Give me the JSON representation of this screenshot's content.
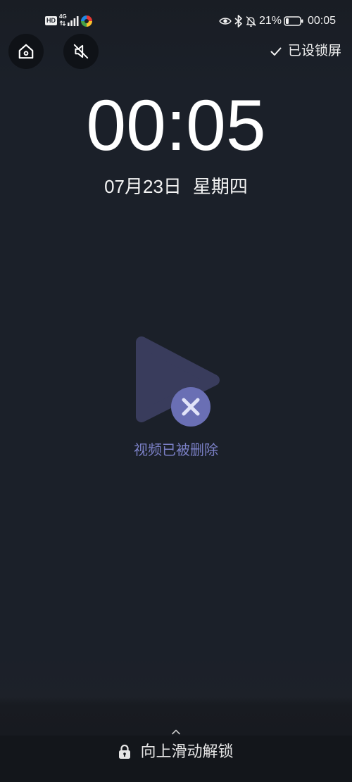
{
  "status_bar": {
    "hd_label": "HD",
    "network_type": "4G",
    "signal_level": 4,
    "battery_label": "21%",
    "battery_level": 0.21,
    "time": "00:05",
    "icons": [
      "data-activity-icon",
      "signal-icon",
      "app-notification-icon",
      "eye-icon",
      "bluetooth-icon",
      "bell-off-icon",
      "battery-icon"
    ]
  },
  "top_controls": {
    "home_icon": "home-icon",
    "mute_icon": "sound-off-icon",
    "check_icon": "check-icon",
    "lock_wallpaper_label": "已设锁屏"
  },
  "clock": {
    "time": "00:05",
    "date": "07月23日",
    "weekday": "星期四"
  },
  "media": {
    "icon": "play-icon",
    "error_icon": "close-circle-icon",
    "status_text": "视频已被删除"
  },
  "unlock": {
    "chevron_icon": "chevron-up-icon",
    "lock_icon": "lock-icon",
    "hint": "向上滑动解锁"
  },
  "colors": {
    "background": "#1b2029",
    "bottom_bar": "#13161b",
    "play_shape": "#393c5c",
    "accent": "#6a6fb4",
    "accent_mark": "#e1e3f8",
    "status_text": "#7b80c6",
    "text": "#ffffff"
  }
}
